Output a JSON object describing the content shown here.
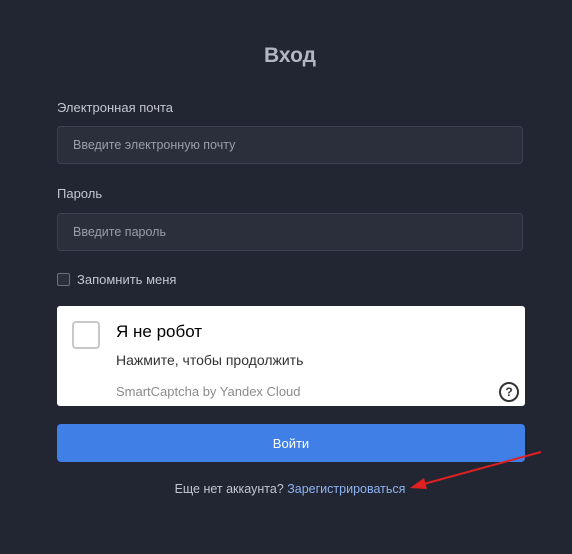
{
  "page": {
    "title": "Вход"
  },
  "email": {
    "label": "Электронная почта",
    "placeholder": "Введите электронную почту"
  },
  "password": {
    "label": "Пароль",
    "placeholder": "Введите пароль"
  },
  "remember": {
    "label": "Запомнить меня"
  },
  "captcha": {
    "title": "Я не робот",
    "subtitle": "Нажмите, чтобы продолжить",
    "brand": "SmartCaptcha by Yandex Cloud",
    "help_glyph": "?"
  },
  "login_button": {
    "label": "Войти"
  },
  "register": {
    "prompt": "Еще нет аккаунта?",
    "link": "Зарегистрироваться"
  },
  "colors": {
    "background": "#222633",
    "accent": "#3f7fe6",
    "annotation_arrow": "#e02020"
  }
}
